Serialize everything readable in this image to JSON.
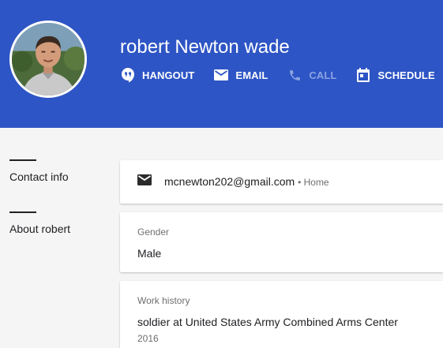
{
  "profile": {
    "name": "robert Newton wade",
    "avatar_alt": "profile photo"
  },
  "actions": [
    {
      "label": "HANGOUT",
      "icon": "hangout-icon",
      "enabled": true
    },
    {
      "label": "EMAIL",
      "icon": "email-icon",
      "enabled": true
    },
    {
      "label": "CALL",
      "icon": "phone-icon",
      "enabled": false
    },
    {
      "label": "SCHEDULE",
      "icon": "calendar-icon",
      "enabled": true
    }
  ],
  "sidenav": {
    "items": [
      {
        "label": "Contact info"
      },
      {
        "label": "About robert"
      }
    ]
  },
  "contact": {
    "email": "mcnewton202@gmail.com",
    "email_type": "• Home",
    "icon": "mail-icon"
  },
  "about": {
    "gender": {
      "label": "Gender",
      "value": "Male"
    },
    "work": {
      "label": "Work history",
      "value": "soldier at United States Army Combined Arms Center",
      "year": "2016"
    }
  },
  "colors": {
    "header": "#2e55c5",
    "page_bg": "#f5f5f5",
    "disabled_text": "#8ca3e2",
    "secondary_text": "#6f6f6f"
  }
}
